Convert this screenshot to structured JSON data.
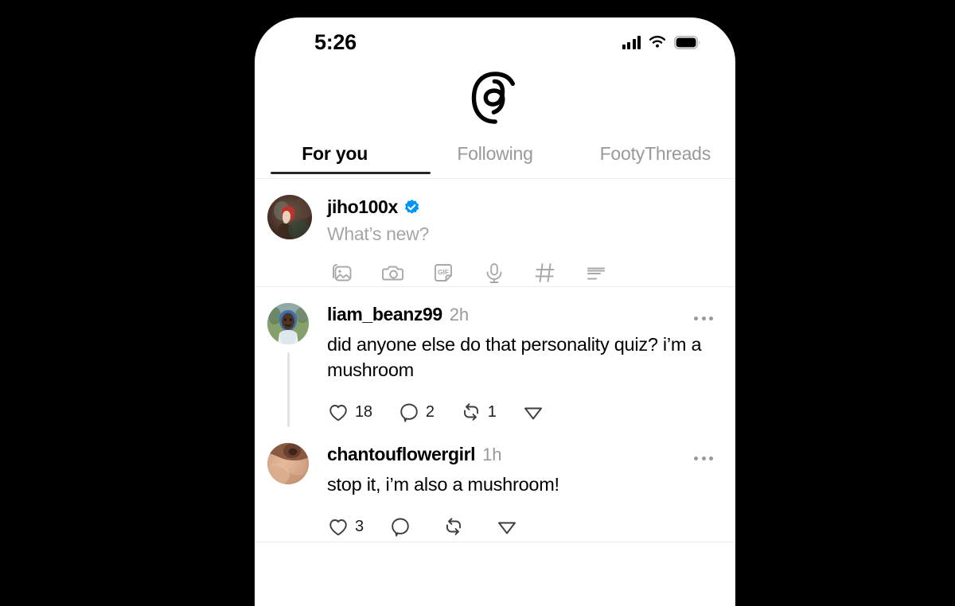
{
  "status_bar": {
    "time": "5:26",
    "signal_icon": "cellular-signal-icon",
    "wifi_icon": "wifi-icon",
    "battery_icon": "battery-full-icon"
  },
  "header": {
    "logo_icon": "threads-logo-icon",
    "tabs": [
      {
        "label": "For you",
        "active": true
      },
      {
        "label": "Following",
        "active": false
      },
      {
        "label": "FootyThreads",
        "active": false
      }
    ]
  },
  "composer": {
    "avatar_name": "composer-avatar",
    "username": "jiho100x",
    "verified": true,
    "verified_color": "#0095f6",
    "placeholder": "What’s new?",
    "icons": [
      {
        "name": "gallery-icon",
        "label": "Photo"
      },
      {
        "name": "camera-icon",
        "label": "Camera"
      },
      {
        "name": "gif-icon",
        "label": "GIF"
      },
      {
        "name": "microphone-icon",
        "label": "Voice"
      },
      {
        "name": "hashtag-icon",
        "label": "Tag"
      },
      {
        "name": "poll-icon",
        "label": "Poll"
      }
    ]
  },
  "feed": {
    "posts": [
      {
        "username": "liam_beanz99",
        "time": "2h",
        "text": "did anyone else do that personality quiz? i’m a mushroom",
        "has_thread_line": true,
        "actions": {
          "like_count": "18",
          "reply_count": "2",
          "repost_count": "1",
          "share_count": ""
        }
      },
      {
        "username": "chantouflowergirl",
        "time": "1h",
        "text": "stop it, i’m also a mushroom!",
        "has_thread_line": false,
        "actions": {
          "like_count": "3",
          "reply_count": "",
          "repost_count": "",
          "share_count": ""
        }
      }
    ]
  },
  "theme": {
    "background": "#000000",
    "screen": "#ffffff",
    "text_primary": "#000000",
    "text_secondary": "#999999",
    "divider": "#ededed",
    "accent_blue": "#0095f6"
  }
}
